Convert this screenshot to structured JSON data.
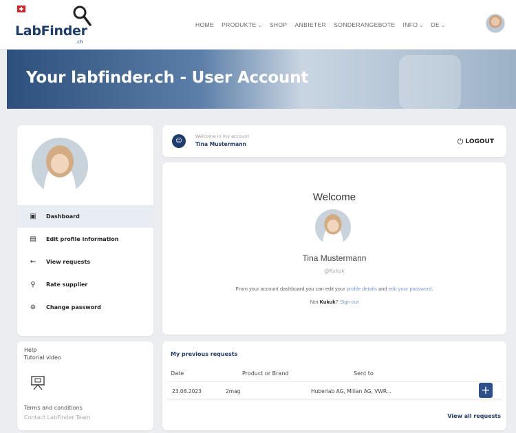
{
  "brand": {
    "name": "LabFinder",
    "sub": ".ch"
  },
  "nav": {
    "items": [
      {
        "label": "HOME",
        "dropdown": false
      },
      {
        "label": "PRODUKTE",
        "dropdown": true
      },
      {
        "label": "SHOP",
        "dropdown": false
      },
      {
        "label": "ANBIETER",
        "dropdown": false
      },
      {
        "label": "SONDERANGEBOTE",
        "dropdown": false
      },
      {
        "label": "INFO",
        "dropdown": true
      },
      {
        "label": "DE",
        "dropdown": true
      }
    ]
  },
  "hero": {
    "title": "Your labfinder.ch - User Account"
  },
  "sidebar": {
    "items": [
      {
        "label": "Dashboard",
        "icon": "dashboard-icon",
        "active": true
      },
      {
        "label": "Edit profile information",
        "icon": "edit-profile-icon",
        "active": false
      },
      {
        "label": "View requests",
        "icon": "requests-icon",
        "active": false
      },
      {
        "label": "Rate supplier",
        "icon": "rate-icon",
        "active": false
      },
      {
        "label": "Change password",
        "icon": "lock-icon",
        "active": false
      }
    ]
  },
  "help": {
    "title": "Help",
    "video": "Tutorial video",
    "terms": "Terms and conditions",
    "contact": "Contact LabFinder Team"
  },
  "welcome_bar": {
    "small": "Welcome in my account",
    "name": "Tina Mustermann",
    "logout": "LOGOUT"
  },
  "main": {
    "title": "Welcome",
    "name": "Tina Mustermann",
    "username": "@Kukuk",
    "text_pre": "From your account dashboard you can edit your ",
    "link_profile": "profile details",
    "text_mid": " and ",
    "link_password": "edit your password",
    "text_end": ".",
    "not_pre": "Not ",
    "not_user": "Kukuk",
    "not_q": "? ",
    "sign_out": "Sign out"
  },
  "requests": {
    "title": "My previous requests",
    "columns": [
      "Date",
      "Product or Brand",
      "Sent to"
    ],
    "rows": [
      {
        "date": "23.08.2023",
        "product": "2mag",
        "sent_to": "Huberlab AG, Milian AG, VWR..."
      }
    ],
    "view_all": "View all requests"
  },
  "colors": {
    "brand_navy": "#1f3c6e",
    "link": "#7a9cd4",
    "active_bg": "#e8ecf3"
  }
}
